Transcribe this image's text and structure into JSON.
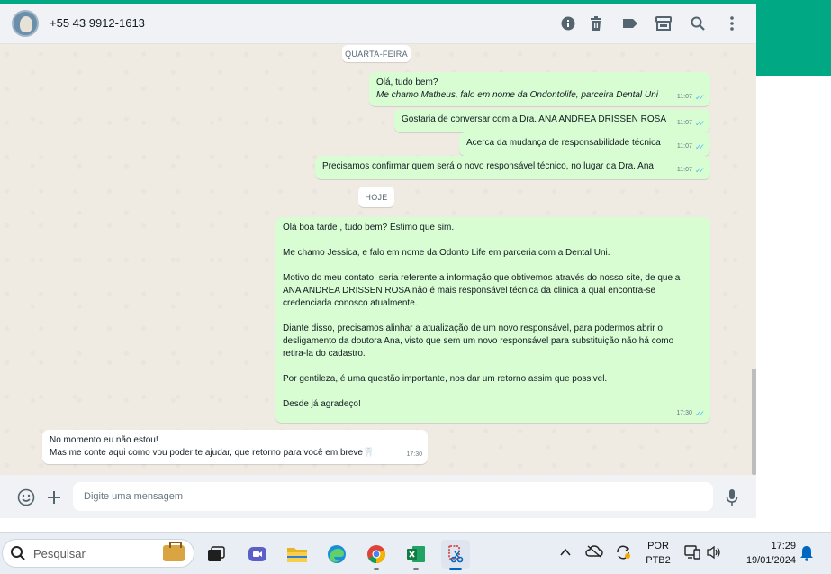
{
  "header": {
    "contact_name": "+55 43 9912-1613",
    "icons": [
      "info-icon",
      "trash-icon",
      "label-icon",
      "store-icon",
      "search-icon",
      "more-icon"
    ]
  },
  "chat": {
    "day_separators": [
      "QUARTA-FEIRA",
      "HOJE"
    ],
    "messages": [
      {
        "direction": "outgoing",
        "line1": "Olá, tudo bem?",
        "line2": "Me chamo Matheus, falo em nome da Ondontolife, parceira Dental Uni",
        "time": "11:07",
        "status": "read"
      },
      {
        "direction": "outgoing",
        "text": "Gostaria de conversar com a Dra. ANA ANDREA DRISSEN ROSA",
        "time": "11:07",
        "status": "read"
      },
      {
        "direction": "outgoing",
        "text": "Acerca da mudança de responsabilidade técnica",
        "time": "11:07",
        "status": "read"
      },
      {
        "direction": "outgoing",
        "text": "Precisamos confirmar quem será o novo responsável técnico, no lugar da Dra. Ana",
        "time": "11:07",
        "status": "read"
      },
      {
        "direction": "outgoing",
        "text": "Olá boa tarde , tudo bem? Estimo que sim.\n\nMe chamo Jessica, e falo em nome da Odonto Life em parceria com a Dental Uni.\n\nMotivo do meu contato, seria referente a informação que obtivemos através do nosso site, de que a\nANA ANDREA DRISSEN ROSA não é mais responsável técnica da clinica a qual encontra-se\ncredenciada conosco atualmente.\n\nDiante disso, precisamos alinhar a atualização de um novo responsável, para podermos abrir o\ndesligamento da doutora Ana, visto que sem um novo responsável para substituição não há como\nretira-la do cadastro.\n\nPor gentileza, é uma questão importante, nos dar um retorno assim que possivel.\n\nDesde já agradeço!",
        "time": "17:30",
        "status": "read"
      },
      {
        "direction": "incoming",
        "text": "No momento eu não estou!\nMas me conte aqui como vou poder te ajudar, que retorno para você em  breve🦷",
        "time": "17:30"
      }
    ]
  },
  "composer": {
    "placeholder": "Digite uma mensagem",
    "icons": [
      "emoji-icon",
      "attach-plus-icon",
      "microphone-icon"
    ]
  },
  "taskbar": {
    "search_label": "Pesquisar",
    "apps": [
      "task-view",
      "video-chat",
      "file-explorer",
      "edge-browser",
      "chrome-browser",
      "excel",
      "snipping-tool"
    ],
    "language_line1": "POR",
    "language_line2": "PTB2",
    "time": "17:29",
    "date": "19/01/2024"
  },
  "colors": {
    "brand_green": "#00a884",
    "outgoing_bubble": "#d9fdd3",
    "incoming_bubble": "#ffffff",
    "chat_bg": "#efeae2",
    "read_ticks": "#53bdeb"
  }
}
